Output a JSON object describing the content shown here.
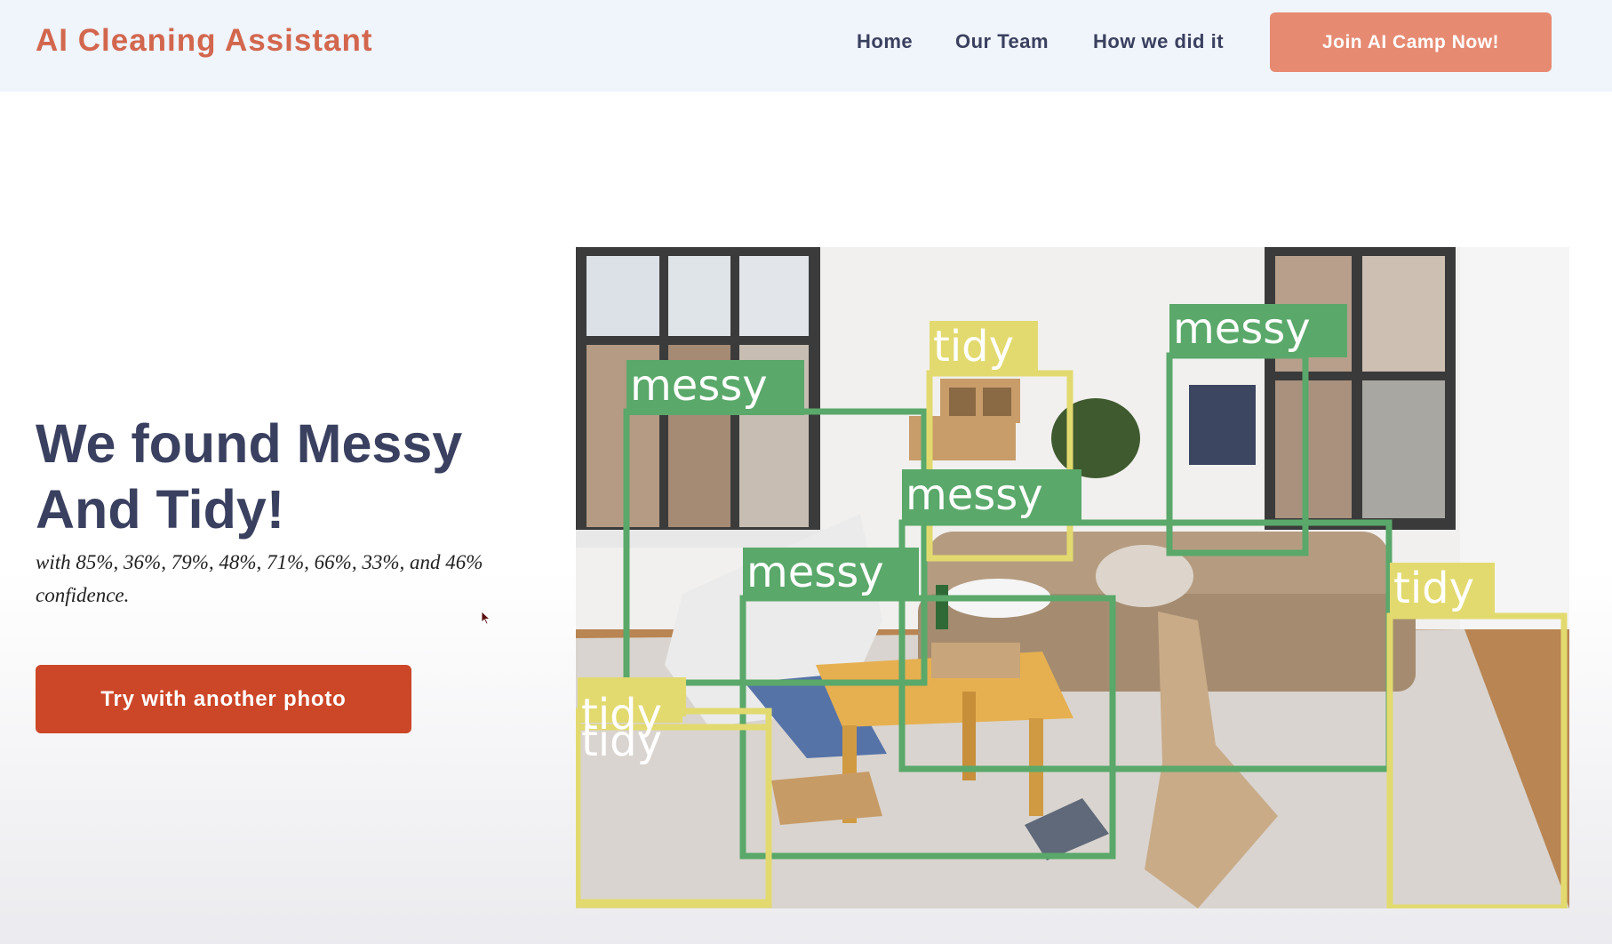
{
  "header": {
    "brand": "AI Cleaning Assistant",
    "nav": [
      "Home",
      "Our Team",
      "How we did it"
    ],
    "cta_label": "Join AI Camp Now!"
  },
  "hero": {
    "title_line1": "We found Messy",
    "title_line2": "And Tidy!",
    "subtitle": "with 85%, 36%, 79%, 48%, 71%, 66%, 33%, and 46% confidence.",
    "button_label": "Try with another photo"
  },
  "detections": [
    {
      "label": "messy"
    },
    {
      "label": "tidy"
    },
    {
      "label": "messy"
    },
    {
      "label": "messy"
    },
    {
      "label": "messy"
    },
    {
      "label": "tidy"
    },
    {
      "label": "tidy"
    },
    {
      "label": "tidy"
    }
  ],
  "colors": {
    "brand": "#d2674e",
    "nav_text": "#3a405f",
    "cta_bg": "#e68a72",
    "button_bg": "#cc4628",
    "messy_box": "#5aa86a",
    "tidy_box": "#e2da6f"
  }
}
